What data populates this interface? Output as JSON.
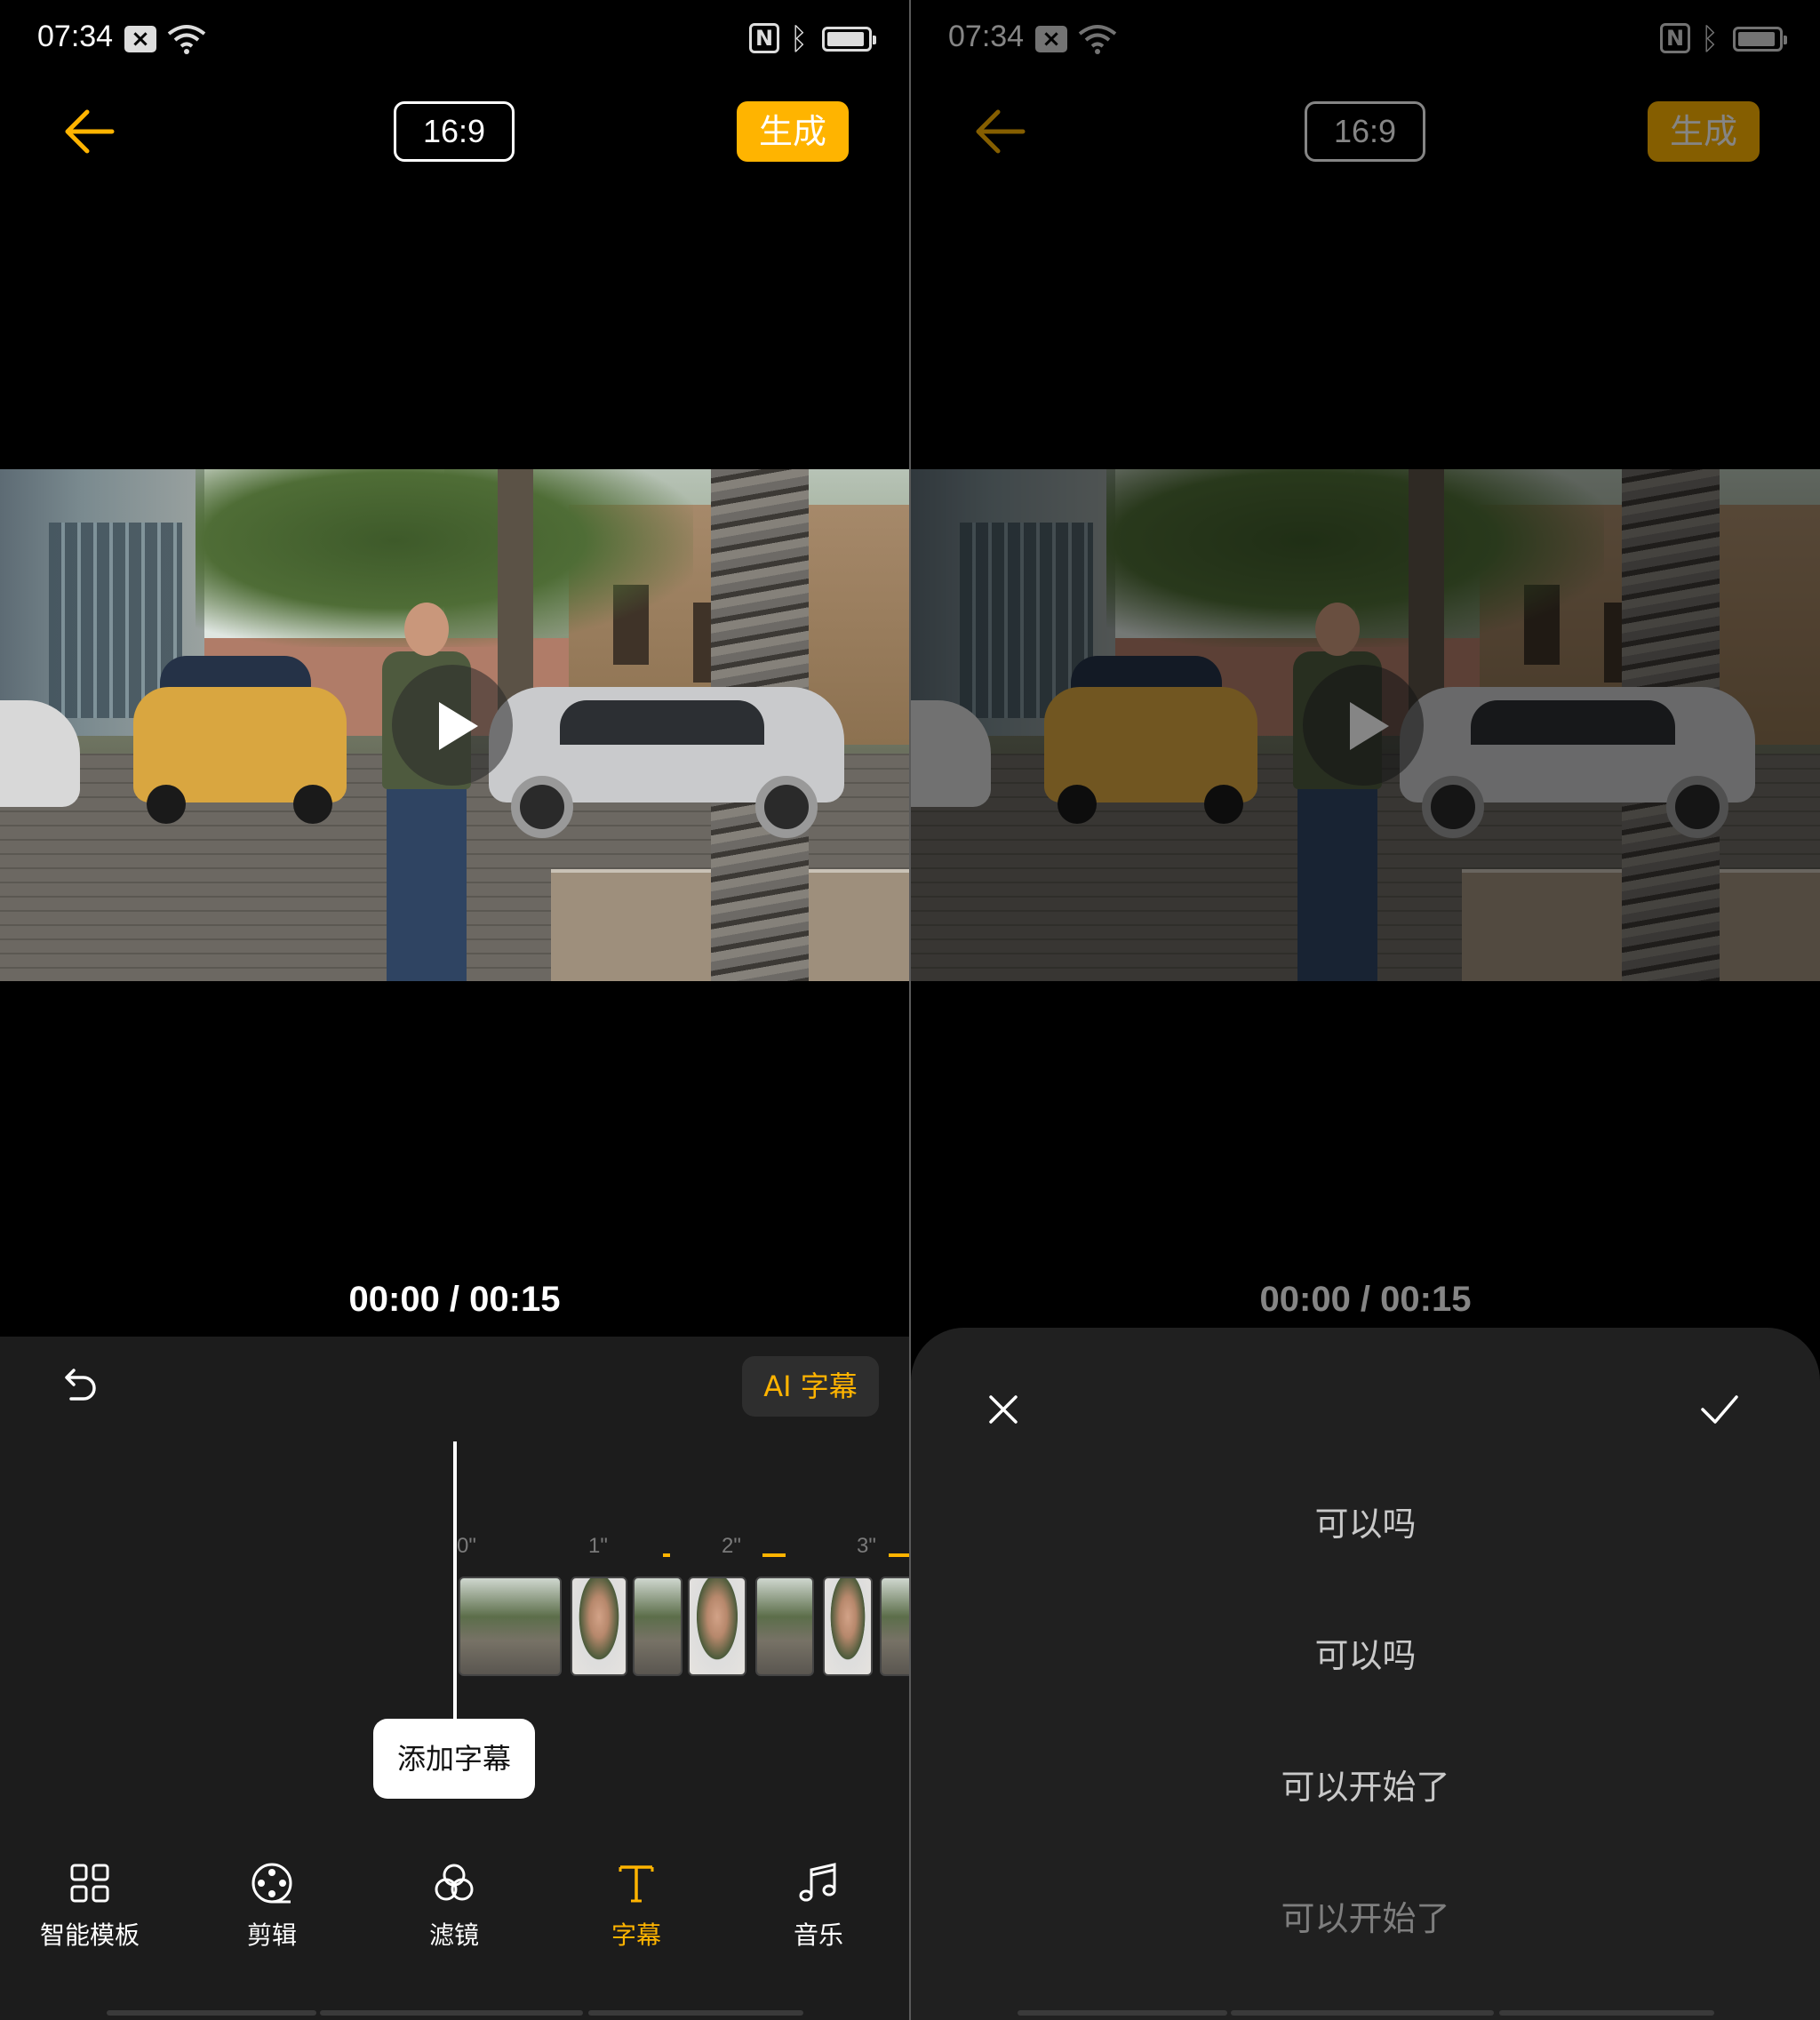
{
  "status_bar": {
    "time": "07:34",
    "icons": [
      "notification-x-icon",
      "wifi-icon",
      "nfc-icon",
      "bluetooth-icon",
      "battery-icon"
    ]
  },
  "header": {
    "back_icon": "arrow-left-icon",
    "ratio": "16:9",
    "generate": "生成"
  },
  "video": {
    "timecode": "00:00 / 00:15"
  },
  "editor": {
    "undo_icon": "undo-icon",
    "ai_caption": "AI 字幕",
    "timeline_ticks": [
      "0\"",
      "1\"",
      "2\"",
      "3\""
    ],
    "add_caption_tooltip": "添加字幕"
  },
  "toolbar": {
    "items": [
      {
        "label": "智能模板",
        "icon": "grid-icon"
      },
      {
        "label": "剪辑",
        "icon": "film-reel-icon"
      },
      {
        "label": "滤镜",
        "icon": "filter-circles-icon"
      },
      {
        "label": "字幕",
        "icon": "text-t-icon",
        "active": true
      },
      {
        "label": "音乐",
        "icon": "music-note-icon"
      }
    ]
  },
  "caption_sheet": {
    "close_icon": "close-icon",
    "confirm_icon": "check-icon",
    "captions": [
      "可以吗",
      "可以吗",
      "可以开始了",
      "可以开始了"
    ]
  },
  "colors": {
    "accent": "#FFB400",
    "background": "#000000",
    "panel": "#1C1C1C",
    "sheet": "#202020"
  }
}
